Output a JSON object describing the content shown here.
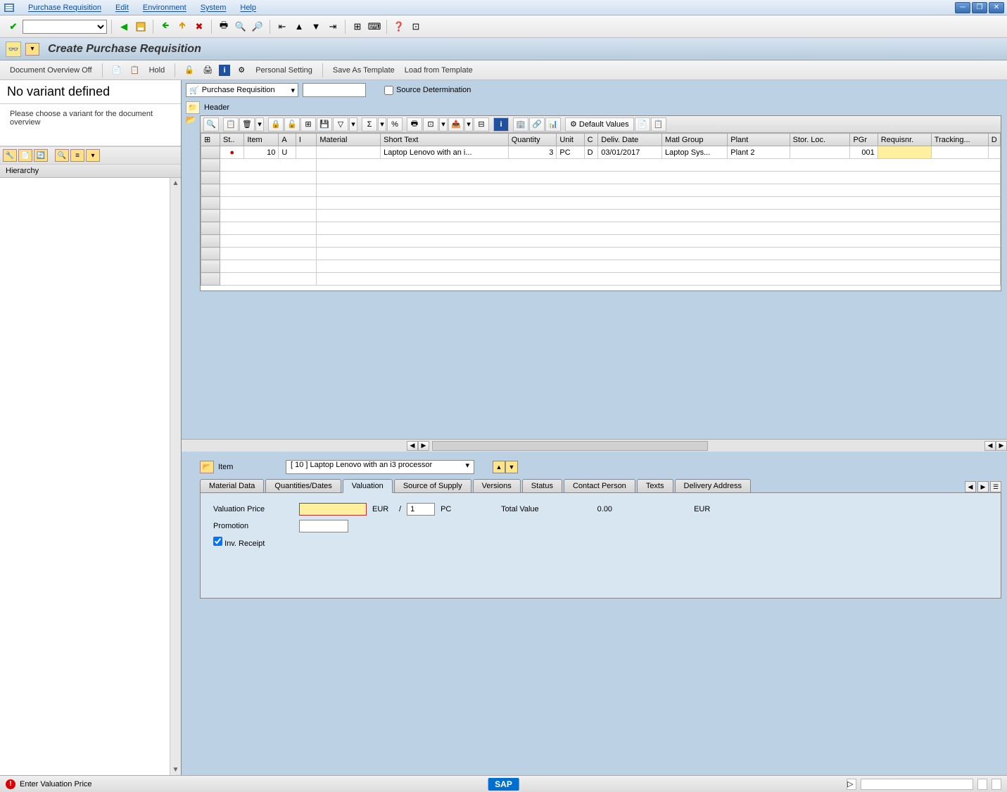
{
  "menu": {
    "items": [
      "Purchase Requisition",
      "Edit",
      "Environment",
      "System",
      "Help"
    ]
  },
  "title": "Create Purchase Requisition",
  "app_toolbar": {
    "doc_overview": "Document Overview Off",
    "hold": "Hold",
    "personal": "Personal Setting",
    "save_tmpl": "Save As Template",
    "load_tmpl": "Load from Template"
  },
  "left": {
    "heading": "No variant defined",
    "hint": "Please choose a variant for the document overview",
    "hierarchy": "Hierarchy"
  },
  "pr_header": {
    "type_label": "Purchase Requisition",
    "number": "",
    "source_det": "Source Determination",
    "header": "Header"
  },
  "grid": {
    "columns": [
      "St..",
      "Item",
      "A",
      "I",
      "Material",
      "Short Text",
      "Quantity",
      "Unit",
      "C",
      "Deliv. Date",
      "Matl Group",
      "Plant",
      "Stor. Loc.",
      "PGr",
      "Requisnr.",
      "Tracking...",
      "D"
    ],
    "rows": [
      {
        "st": "●",
        "item": "10",
        "a": "U",
        "i": "",
        "material": "",
        "short_text": "Laptop Lenovo with an i...",
        "qty": "3",
        "unit": "PC",
        "c": "D",
        "deliv": "03/01/2017",
        "matlgrp": "Laptop Sys...",
        "plant": "Plant 2",
        "stor": "",
        "pgr": "001",
        "requisnr": "",
        "tracking": ""
      }
    ],
    "default_values": "Default Values"
  },
  "item_detail": {
    "label": "Item",
    "selected": "[ 10 ] Laptop Lenovo with an i3 processor",
    "tabs": [
      "Material Data",
      "Quantities/Dates",
      "Valuation",
      "Source of Supply",
      "Versions",
      "Status",
      "Contact Person",
      "Texts",
      "Delivery Address"
    ],
    "active_tab": "Valuation",
    "valuation": {
      "price_label": "Valuation Price",
      "price": "",
      "currency": "EUR",
      "per": "1",
      "per_unit": "PC",
      "total_label": "Total Value",
      "total": "0.00",
      "total_curr": "EUR",
      "promotion_label": "Promotion",
      "promotion": "",
      "inv_receipt_label": "Inv. Receipt",
      "inv_receipt": true,
      "slash": "/"
    }
  },
  "status": {
    "message": "Enter Valuation Price",
    "sap": "SAP"
  }
}
